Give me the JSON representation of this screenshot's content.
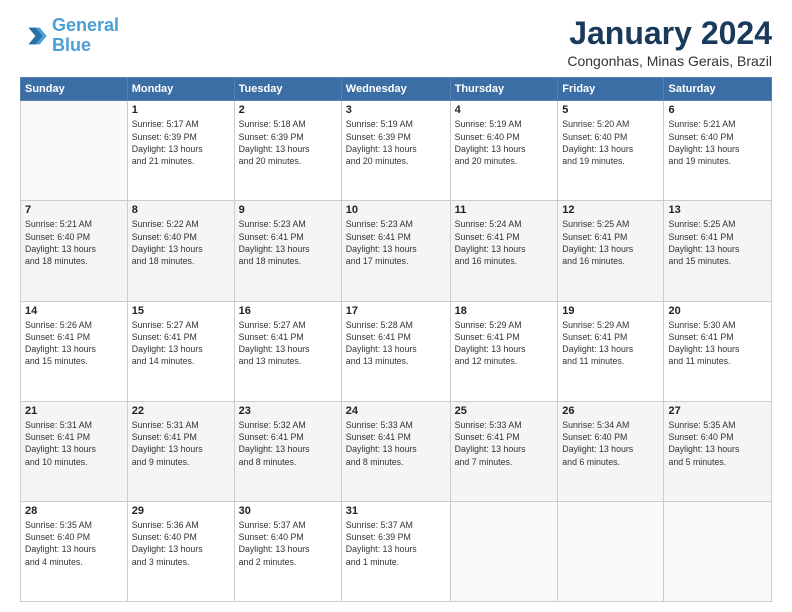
{
  "logo": {
    "line1": "General",
    "line2": "Blue"
  },
  "title": "January 2024",
  "subtitle": "Congonhas, Minas Gerais, Brazil",
  "weekdays": [
    "Sunday",
    "Monday",
    "Tuesday",
    "Wednesday",
    "Thursday",
    "Friday",
    "Saturday"
  ],
  "weeks": [
    [
      {
        "day": "",
        "info": ""
      },
      {
        "day": "1",
        "info": "Sunrise: 5:17 AM\nSunset: 6:39 PM\nDaylight: 13 hours\nand 21 minutes."
      },
      {
        "day": "2",
        "info": "Sunrise: 5:18 AM\nSunset: 6:39 PM\nDaylight: 13 hours\nand 20 minutes."
      },
      {
        "day": "3",
        "info": "Sunrise: 5:19 AM\nSunset: 6:39 PM\nDaylight: 13 hours\nand 20 minutes."
      },
      {
        "day": "4",
        "info": "Sunrise: 5:19 AM\nSunset: 6:40 PM\nDaylight: 13 hours\nand 20 minutes."
      },
      {
        "day": "5",
        "info": "Sunrise: 5:20 AM\nSunset: 6:40 PM\nDaylight: 13 hours\nand 19 minutes."
      },
      {
        "day": "6",
        "info": "Sunrise: 5:21 AM\nSunset: 6:40 PM\nDaylight: 13 hours\nand 19 minutes."
      }
    ],
    [
      {
        "day": "7",
        "info": "Sunrise: 5:21 AM\nSunset: 6:40 PM\nDaylight: 13 hours\nand 18 minutes."
      },
      {
        "day": "8",
        "info": "Sunrise: 5:22 AM\nSunset: 6:40 PM\nDaylight: 13 hours\nand 18 minutes."
      },
      {
        "day": "9",
        "info": "Sunrise: 5:23 AM\nSunset: 6:41 PM\nDaylight: 13 hours\nand 18 minutes."
      },
      {
        "day": "10",
        "info": "Sunrise: 5:23 AM\nSunset: 6:41 PM\nDaylight: 13 hours\nand 17 minutes."
      },
      {
        "day": "11",
        "info": "Sunrise: 5:24 AM\nSunset: 6:41 PM\nDaylight: 13 hours\nand 16 minutes."
      },
      {
        "day": "12",
        "info": "Sunrise: 5:25 AM\nSunset: 6:41 PM\nDaylight: 13 hours\nand 16 minutes."
      },
      {
        "day": "13",
        "info": "Sunrise: 5:25 AM\nSunset: 6:41 PM\nDaylight: 13 hours\nand 15 minutes."
      }
    ],
    [
      {
        "day": "14",
        "info": "Sunrise: 5:26 AM\nSunset: 6:41 PM\nDaylight: 13 hours\nand 15 minutes."
      },
      {
        "day": "15",
        "info": "Sunrise: 5:27 AM\nSunset: 6:41 PM\nDaylight: 13 hours\nand 14 minutes."
      },
      {
        "day": "16",
        "info": "Sunrise: 5:27 AM\nSunset: 6:41 PM\nDaylight: 13 hours\nand 13 minutes."
      },
      {
        "day": "17",
        "info": "Sunrise: 5:28 AM\nSunset: 6:41 PM\nDaylight: 13 hours\nand 13 minutes."
      },
      {
        "day": "18",
        "info": "Sunrise: 5:29 AM\nSunset: 6:41 PM\nDaylight: 13 hours\nand 12 minutes."
      },
      {
        "day": "19",
        "info": "Sunrise: 5:29 AM\nSunset: 6:41 PM\nDaylight: 13 hours\nand 11 minutes."
      },
      {
        "day": "20",
        "info": "Sunrise: 5:30 AM\nSunset: 6:41 PM\nDaylight: 13 hours\nand 11 minutes."
      }
    ],
    [
      {
        "day": "21",
        "info": "Sunrise: 5:31 AM\nSunset: 6:41 PM\nDaylight: 13 hours\nand 10 minutes."
      },
      {
        "day": "22",
        "info": "Sunrise: 5:31 AM\nSunset: 6:41 PM\nDaylight: 13 hours\nand 9 minutes."
      },
      {
        "day": "23",
        "info": "Sunrise: 5:32 AM\nSunset: 6:41 PM\nDaylight: 13 hours\nand 8 minutes."
      },
      {
        "day": "24",
        "info": "Sunrise: 5:33 AM\nSunset: 6:41 PM\nDaylight: 13 hours\nand 8 minutes."
      },
      {
        "day": "25",
        "info": "Sunrise: 5:33 AM\nSunset: 6:41 PM\nDaylight: 13 hours\nand 7 minutes."
      },
      {
        "day": "26",
        "info": "Sunrise: 5:34 AM\nSunset: 6:40 PM\nDaylight: 13 hours\nand 6 minutes."
      },
      {
        "day": "27",
        "info": "Sunrise: 5:35 AM\nSunset: 6:40 PM\nDaylight: 13 hours\nand 5 minutes."
      }
    ],
    [
      {
        "day": "28",
        "info": "Sunrise: 5:35 AM\nSunset: 6:40 PM\nDaylight: 13 hours\nand 4 minutes."
      },
      {
        "day": "29",
        "info": "Sunrise: 5:36 AM\nSunset: 6:40 PM\nDaylight: 13 hours\nand 3 minutes."
      },
      {
        "day": "30",
        "info": "Sunrise: 5:37 AM\nSunset: 6:40 PM\nDaylight: 13 hours\nand 2 minutes."
      },
      {
        "day": "31",
        "info": "Sunrise: 5:37 AM\nSunset: 6:39 PM\nDaylight: 13 hours\nand 1 minute."
      },
      {
        "day": "",
        "info": ""
      },
      {
        "day": "",
        "info": ""
      },
      {
        "day": "",
        "info": ""
      }
    ]
  ]
}
